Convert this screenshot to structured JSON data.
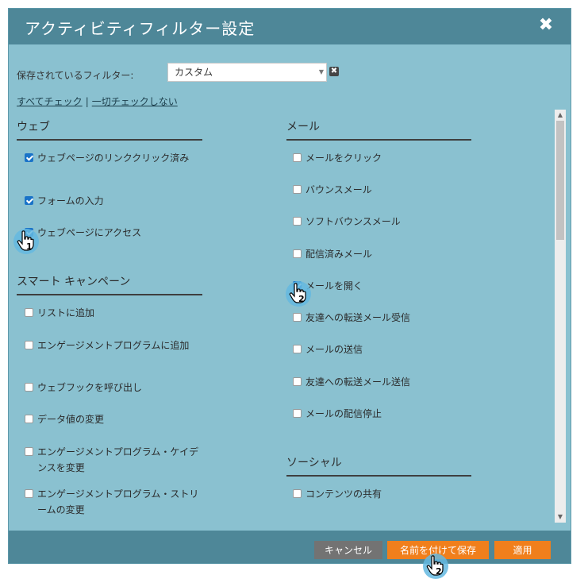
{
  "dialog": {
    "title": "アクティビティフィルター設定",
    "close_label": "✖"
  },
  "saved_filter": {
    "label": "保存されているフィルター:",
    "value": "カスタム",
    "clear_label": "✖"
  },
  "links": {
    "check_all": "すべてチェック",
    "separator": "|",
    "uncheck_all": "一切チェックしない"
  },
  "sections": {
    "web": {
      "header": "ウェブ",
      "items": [
        {
          "label": "ウェブページのリンククリック済み",
          "checked": true
        },
        {
          "label": "フォームの入力",
          "checked": true
        },
        {
          "label": "ウェブページにアクセス",
          "checked": true
        }
      ]
    },
    "smart_campaign": {
      "header": "スマート キャンペーン",
      "items": [
        {
          "label": "リストに追加",
          "checked": false
        },
        {
          "label": "エンゲージメントプログラムに追加",
          "checked": false
        },
        {
          "label": "ウェブフックを呼び出し",
          "checked": false
        },
        {
          "label": "データ値の変更",
          "checked": false
        },
        {
          "label": "エンゲージメントプログラム・ケイデンスを変更",
          "checked": false
        },
        {
          "label": "エンゲージメントプログラム・ストリームの変更",
          "checked": false
        }
      ]
    },
    "mail": {
      "header": "メール",
      "items": [
        {
          "label": "メールをクリック",
          "checked": false
        },
        {
          "label": "バウンスメール",
          "checked": false
        },
        {
          "label": "ソフトバウンスメール",
          "checked": false
        },
        {
          "label": "配信済みメール",
          "checked": false
        },
        {
          "label": "メールを開く",
          "checked": true
        },
        {
          "label": "友達への転送メール受信",
          "checked": false
        },
        {
          "label": "メールの送信",
          "checked": false
        },
        {
          "label": "友達への転送メール送信",
          "checked": false
        },
        {
          "label": "メールの配信停止",
          "checked": false
        }
      ]
    },
    "social": {
      "header": "ソーシャル",
      "items": [
        {
          "label": "コンテンツの共有",
          "checked": false
        }
      ]
    }
  },
  "footer": {
    "cancel_label": "キャンセル",
    "save_as_label": "名前を付けて保存",
    "apply_label": "適用"
  },
  "annotations": {
    "cursor1": "1",
    "cursor2": "2",
    "cursor3": "2"
  }
}
